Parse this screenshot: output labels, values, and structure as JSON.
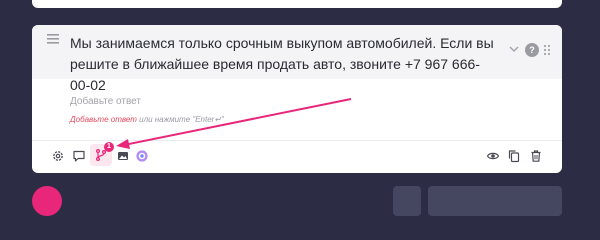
{
  "question": {
    "text": "Мы занимаемся только срочным выкупом автомобилей. Если вы решите в ближайшее время продать авто, звоните +7 967 666-00-02",
    "answers_count": "?"
  },
  "answer_input": {
    "placeholder": "Добавьте ответ",
    "value": ""
  },
  "hint": {
    "link": "Добавьте ответ",
    "rest": " или нажмите \"Enter↵\""
  },
  "toolbar": {
    "branch_badge": "1",
    "icons": [
      "gear-icon",
      "comment-icon",
      "branch-icon",
      "image-icon",
      "ai-icon",
      "eye-icon",
      "copy-icon",
      "trash-icon"
    ]
  },
  "colors": {
    "background": "#2c2d44",
    "card": "#ffffff",
    "header": "#f4f4f6",
    "accent": "#e8267a",
    "link": "#e84a5f"
  }
}
